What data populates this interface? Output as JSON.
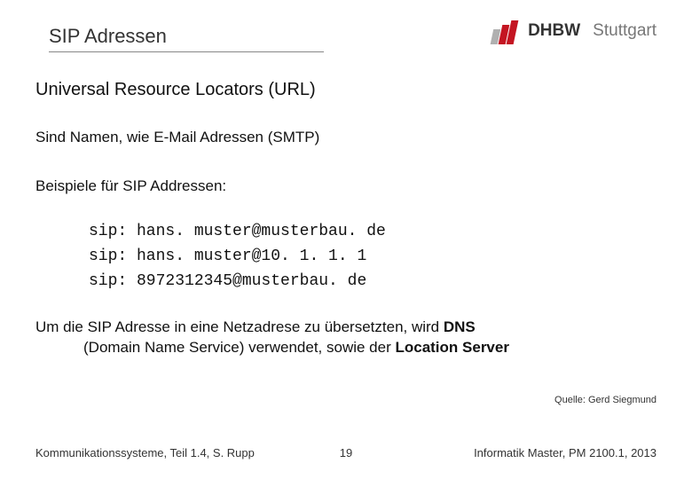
{
  "header": {
    "title": "SIP Adressen",
    "logo": {
      "brand": "DHBW",
      "city": "Stuttgart"
    }
  },
  "content": {
    "subtitle": "Universal Resource Locators (URL)",
    "intro": "Sind Namen, wie E-Mail Adressen (SMTP)",
    "examples_label": "Beispiele für SIP Addressen:",
    "examples": [
      "sip: hans. muster@musterbau. de",
      "sip: hans. muster@10. 1. 1. 1",
      "sip: 8972312345@musterbau. de"
    ],
    "paragraph": {
      "pre": "Um die SIP Adresse in eine Netzadrese zu übersetzten, wird ",
      "bold1": "DNS",
      "mid": " (Domain Name Service) verwendet, sowie der ",
      "bold2": "Location Server"
    },
    "source": "Quelle: Gerd Siegmund"
  },
  "footer": {
    "left": "Kommunikationssysteme, Teil 1.4, S. Rupp",
    "page": "19",
    "right": "Informatik Master, PM 2100.1, 2013"
  }
}
